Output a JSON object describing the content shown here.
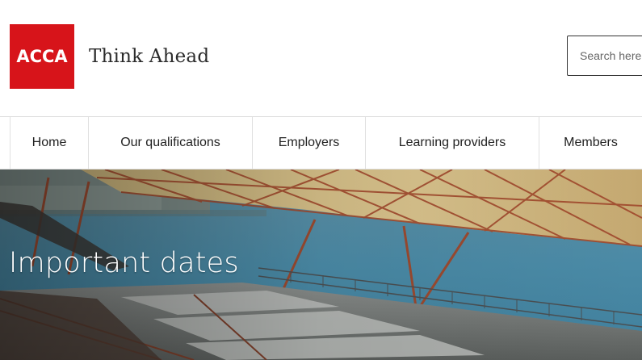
{
  "brand": {
    "logo_text": "ACCA",
    "tagline": "Think Ahead",
    "logo_color": "#d7141a"
  },
  "search": {
    "placeholder": "Search here",
    "value": ""
  },
  "nav": {
    "items": [
      {
        "label": "Home"
      },
      {
        "label": "Our qualifications"
      },
      {
        "label": "Employers"
      },
      {
        "label": "Learning providers"
      },
      {
        "label": "Members"
      }
    ]
  },
  "hero": {
    "title": "Important dates"
  }
}
